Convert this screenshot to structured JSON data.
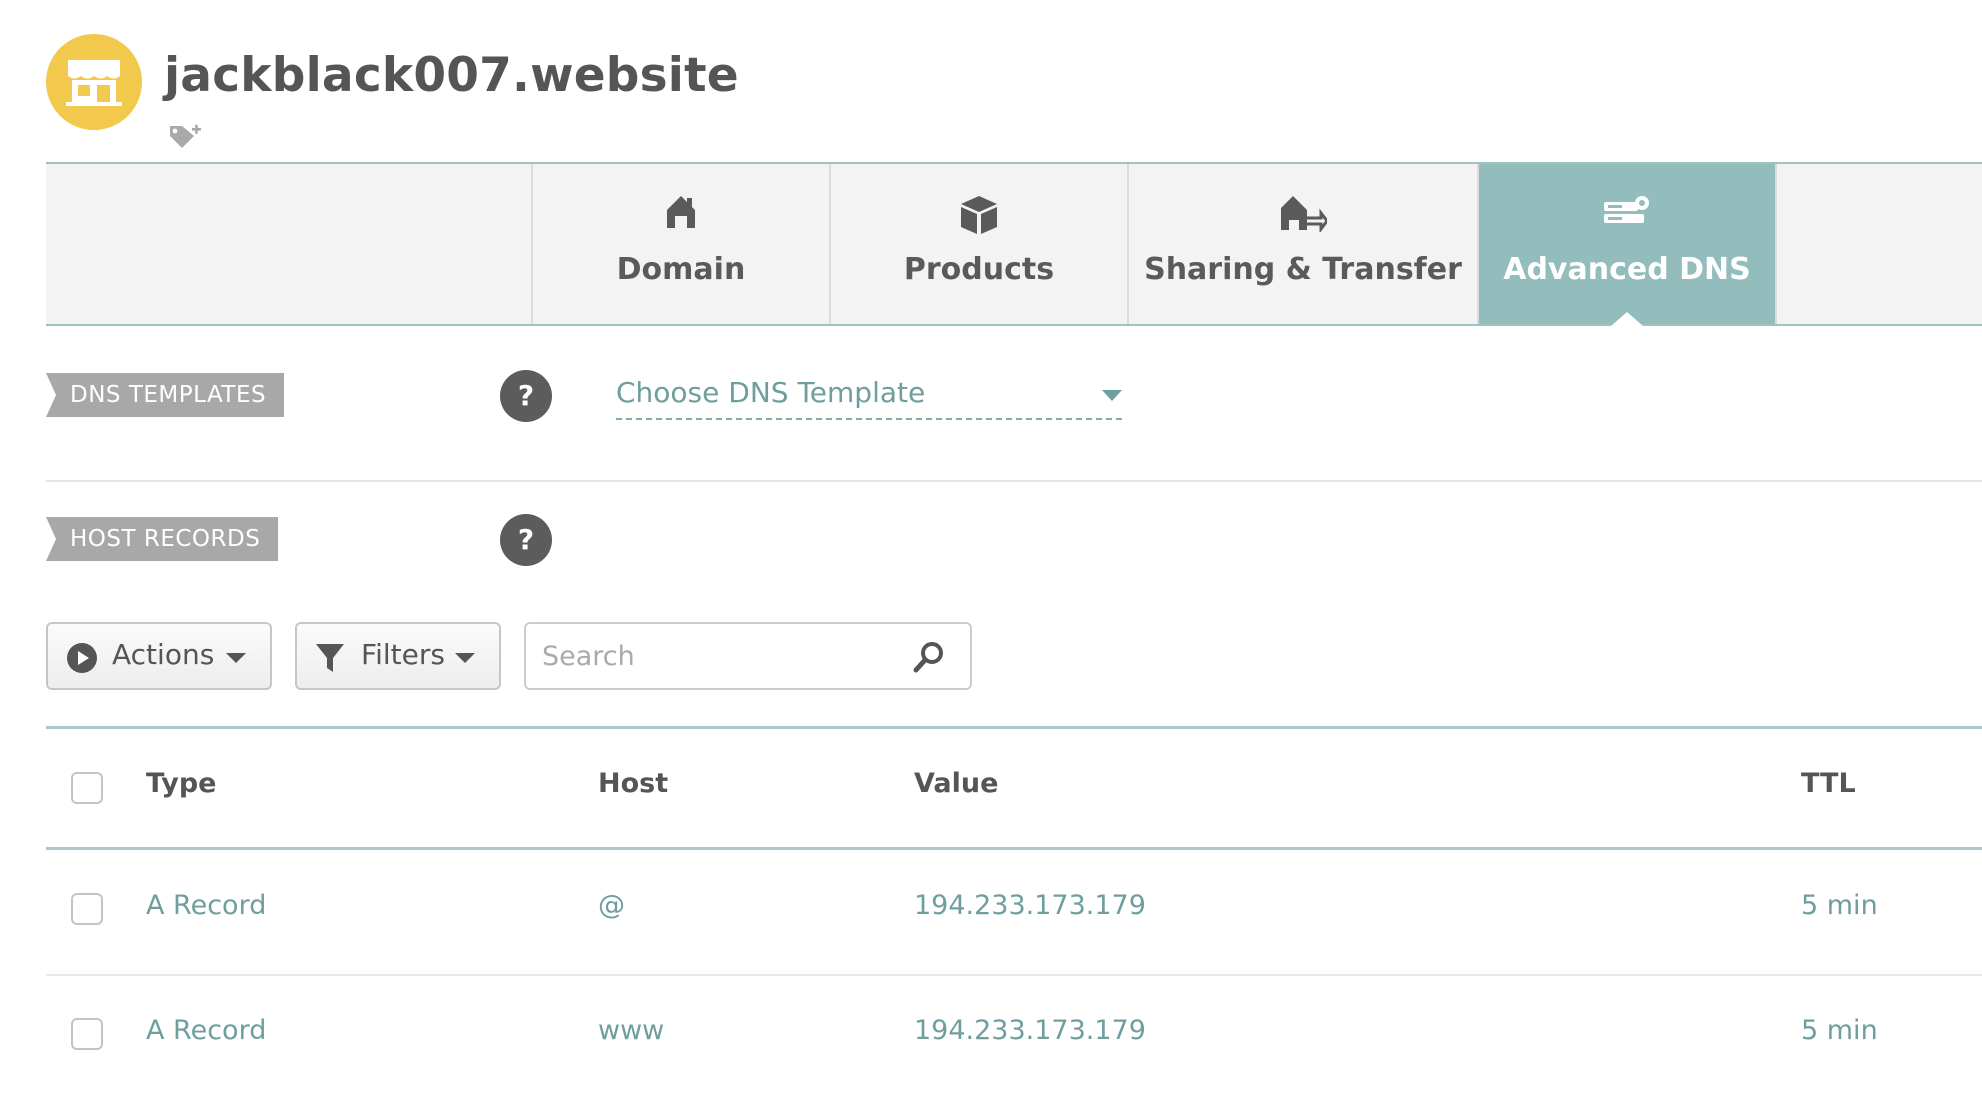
{
  "header": {
    "domain": "jackblack007.website",
    "badge_icon": "store-icon",
    "tag_icon": "tag-add-icon"
  },
  "tabs": [
    {
      "label": "Domain",
      "icon": "home-icon",
      "active": false
    },
    {
      "label": "Products",
      "icon": "box-icon",
      "active": false
    },
    {
      "label": "Sharing & Transfer",
      "icon": "house-transfer-icon",
      "active": false
    },
    {
      "label": "Advanced DNS",
      "icon": "server-gear-icon",
      "active": true
    }
  ],
  "dns_templates": {
    "label": "DNS TEMPLATES",
    "help": "?",
    "select_value": "Choose DNS Template"
  },
  "host_records": {
    "label": "HOST RECORDS",
    "help": "?",
    "actions_label": "Actions",
    "filters_label": "Filters",
    "search_placeholder": "Search",
    "columns": {
      "type": "Type",
      "host": "Host",
      "value": "Value",
      "ttl": "TTL"
    },
    "rows": [
      {
        "type": "A Record",
        "host": "@",
        "value": "194.233.173.179",
        "ttl": "5 min"
      },
      {
        "type": "A Record",
        "host": "www",
        "value": "194.233.173.179",
        "ttl": "5 min"
      }
    ]
  },
  "colors": {
    "accent": "#93bcbc",
    "badge": "#f2c94c",
    "link_text": "#6f9e9e",
    "label_bg": "#a8a8a8"
  }
}
